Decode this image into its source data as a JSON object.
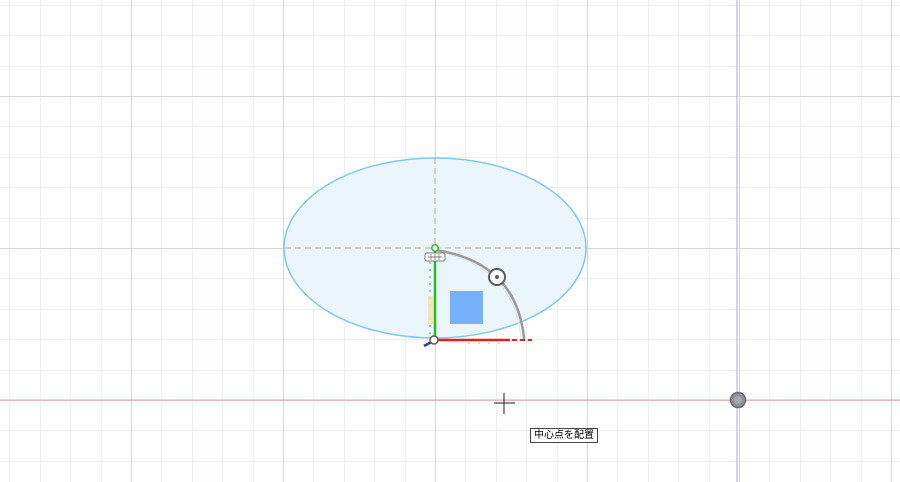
{
  "viewport": {
    "background": "#ffffff",
    "minor_grid_color": "#eceef2",
    "major_grid_color": "#d3d6dd",
    "x_axis_color": "#f2a0a0",
    "y_axis_color": "#a9a9e0"
  },
  "sketch": {
    "ellipse": {
      "fill": "#eaf5fc",
      "stroke": "#7ccbe8"
    },
    "construction_line_color": "#c8a882",
    "triad": {
      "x_axis_color": "#e0201e",
      "y_axis_color": "#20c020",
      "z_axis_color": "#1a3fd0",
      "plane_color": "#6aaaf8",
      "icon": "move-manipulator-icon"
    },
    "rotation_handle": {
      "icon": "rotate-handle-icon"
    }
  },
  "origin_marker": {
    "icon": "origin-point-icon",
    "color": "#8f8f95"
  },
  "cursor": {
    "icon": "crosshair-cursor-icon"
  },
  "tooltip": {
    "text": "中心点を配置"
  }
}
